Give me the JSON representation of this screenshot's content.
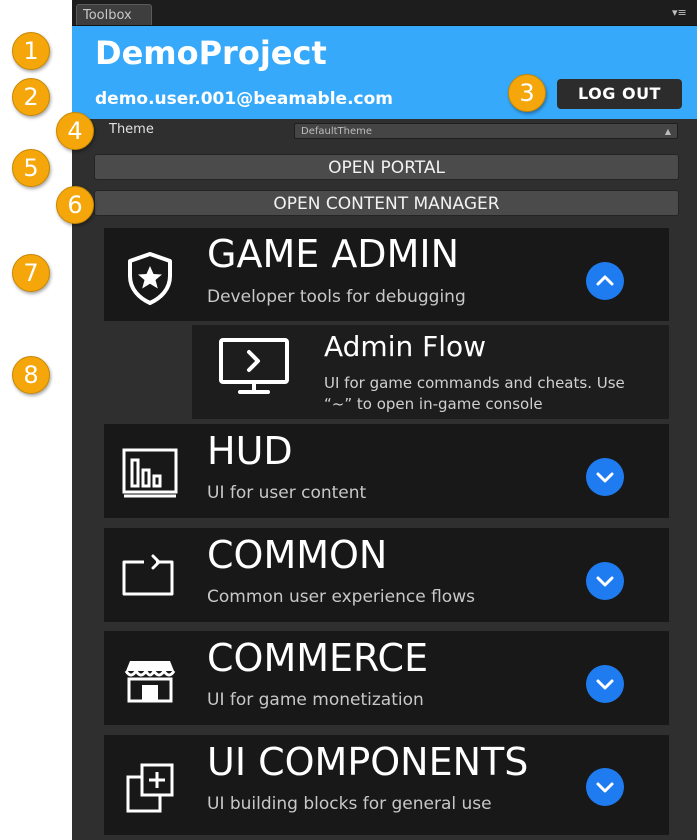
{
  "window": {
    "tab_title": "Toolbox",
    "menu_glyph": "▾≡"
  },
  "header": {
    "project_name": "DemoProject",
    "user_email": "demo.user.001@beamable.com",
    "logout_label": "LOG OUT",
    "background": "#37a9fb"
  },
  "theme": {
    "label": "Theme",
    "selected": "DefaultTheme"
  },
  "buttons": {
    "open_portal": "OPEN PORTAL",
    "open_content_manager": "OPEN CONTENT MANAGER"
  },
  "sections": [
    {
      "title": "GAME ADMIN",
      "description": "Developer tools for debugging",
      "icon": "shield-star-icon",
      "expanded": true
    },
    {
      "title": "HUD",
      "description": "UI for user content",
      "icon": "bar-chart-icon",
      "expanded": false
    },
    {
      "title": "COMMON",
      "description": "Common user experience flows",
      "icon": "return-arrow-icon",
      "expanded": false
    },
    {
      "title": "COMMERCE",
      "description": "UI for game monetization",
      "icon": "storefront-icon",
      "expanded": false
    },
    {
      "title": "UI COMPONENTS",
      "description": "UI building blocks for general use",
      "icon": "add-layers-icon",
      "expanded": false
    }
  ],
  "admin_flow": {
    "title": "Admin Flow",
    "description": "UI for game commands and cheats. Use “~” to open in-game console",
    "icon": "terminal-monitor-icon"
  },
  "callouts": [
    "1",
    "2",
    "3",
    "4",
    "5",
    "6",
    "7",
    "8"
  ],
  "colors": {
    "accent_blue": "#1f7cf0",
    "callout_orange": "#f5a60a",
    "panel_bg": "#2f2f2f",
    "card_bg": "#181818"
  }
}
